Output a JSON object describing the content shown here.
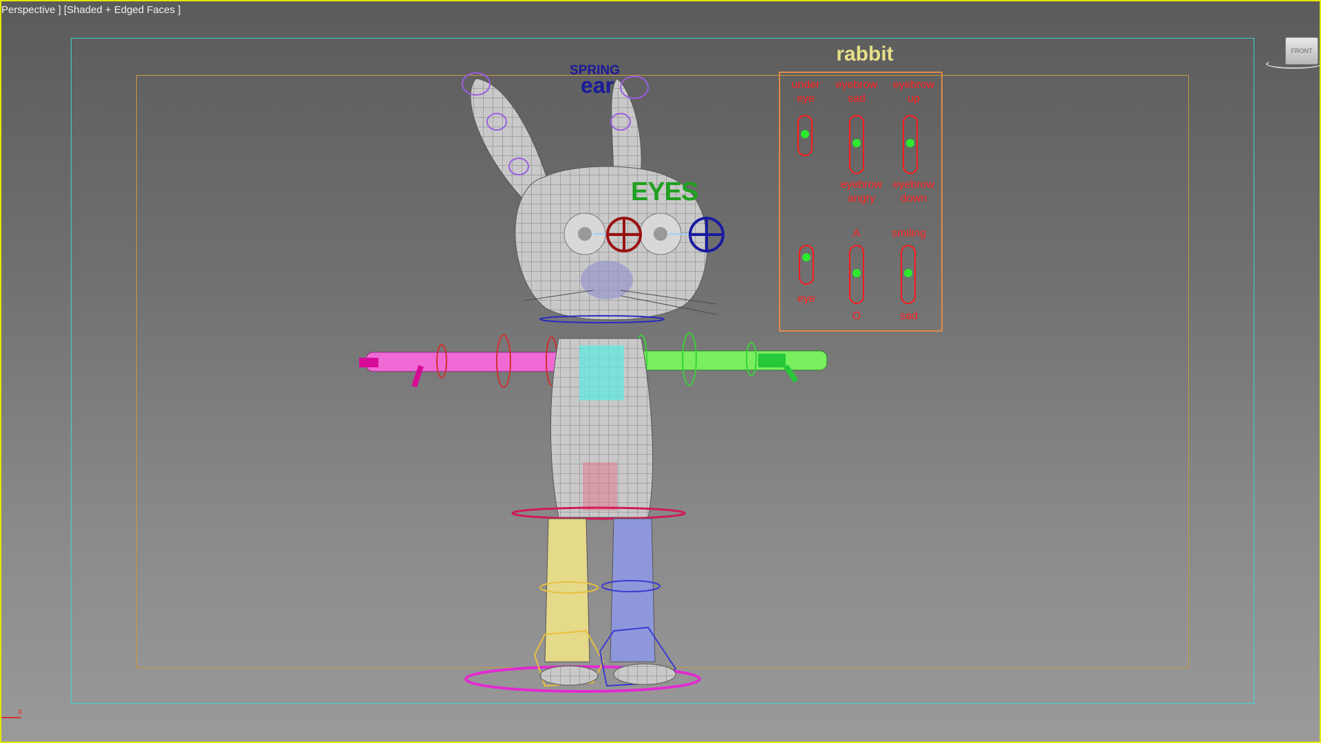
{
  "viewport": {
    "label": "Perspective ] [Shaded + Edged Faces ]",
    "border_color": "#e6e600"
  },
  "viewcube": {
    "face_label": "FRONT"
  },
  "scene": {
    "title": "rabbit",
    "eyes_label": "EYES",
    "spring_label": "SPRING",
    "ear_label": "ear",
    "axis_label": "x"
  },
  "controls": {
    "sliders": [
      {
        "id": "under-eye",
        "top_label": "under\neye",
        "bottom_label": "",
        "value": 0.5
      },
      {
        "id": "eyebrow-sad-angry",
        "top_label": "eyebrow\nsad",
        "bottom_label": "eyebrow\nangry",
        "value": 0.5
      },
      {
        "id": "eyebrow-up-down",
        "top_label": "eyebrow\nup",
        "bottom_label": "eyebrow\ndown",
        "value": 0.5
      },
      {
        "id": "eye",
        "top_label": "",
        "bottom_label": "eye",
        "value": 0.7
      },
      {
        "id": "a-o",
        "top_label": "A",
        "bottom_label": "O",
        "value": 0.5
      },
      {
        "id": "smiling-sad",
        "top_label": "smiling",
        "bottom_label": "sad",
        "value": 0.5
      }
    ],
    "track_color": "#ff1a1a",
    "knob_color": "#2eea2e",
    "panel_border_color": "#e08a4a"
  },
  "colors": {
    "safe_frame_outer": "#3fd3d3",
    "safe_frame_inner": "#c99a3a",
    "label_text": "#ff2020",
    "title_text": "#e7e08a",
    "eyes_text": "#20a020",
    "ear_text": "#1a1a9a"
  }
}
